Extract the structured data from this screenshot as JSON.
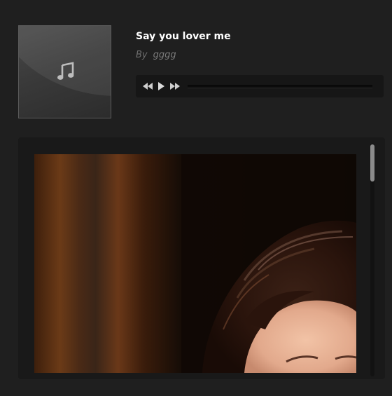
{
  "track": {
    "title": "Say you lover me",
    "by_label": "By",
    "artist": "gggg"
  },
  "album_art": {
    "icon": "music-note-icon"
  },
  "player": {
    "controls": [
      "rewind-icon",
      "play-icon",
      "fast-forward-icon"
    ],
    "progress": 0
  },
  "colors": {
    "background": "#1f1f1f",
    "panel": "#191919",
    "title": "#ffffff",
    "muted": "#6e6e6e",
    "player_bar": "#161616",
    "scroll_thumb": "#8b8b8b"
  },
  "content": {
    "image": "photo of a woman's head"
  }
}
